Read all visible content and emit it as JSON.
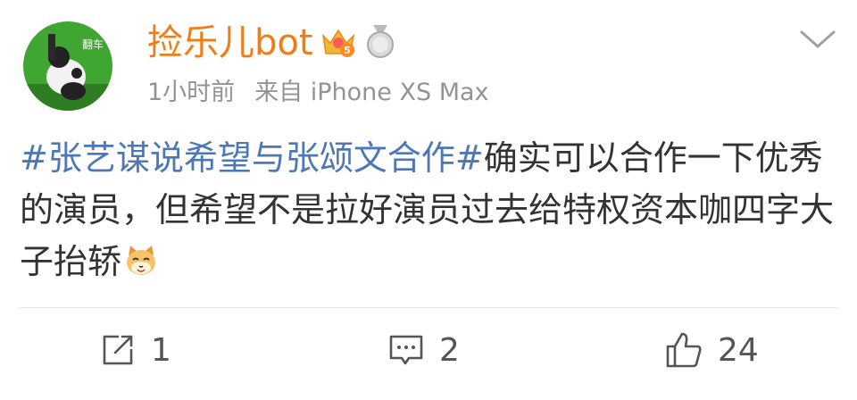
{
  "post": {
    "username": "捡乐儿bot",
    "avatar_label": "翻车",
    "crown_badge_level": "5",
    "time": "1小时前",
    "source": "来自 iPhone XS Max",
    "topic": "#张艺谋说希望与张颂文合作#",
    "text": "确实可以合作一下优秀的演员，但希望不是拉好演员过去给特权资本咖四字大子抬轿",
    "emoji": "cat-face-emoji"
  },
  "actions": {
    "share_count": "1",
    "comment_count": "2",
    "like_count": "24"
  },
  "colors": {
    "username": "#f07c16",
    "topic": "#4d78b5",
    "meta": "#939393"
  }
}
